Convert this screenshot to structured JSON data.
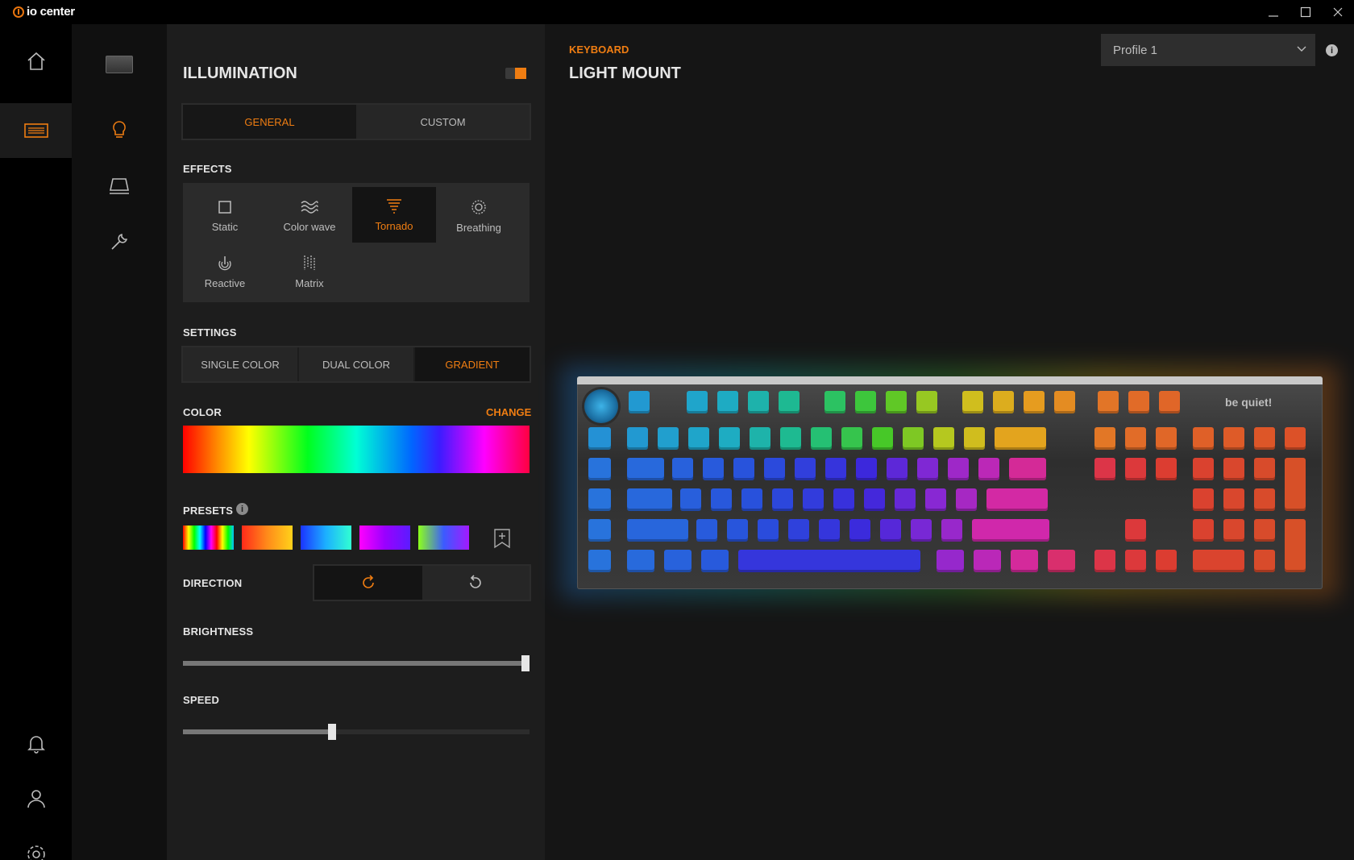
{
  "app": {
    "logo_text": "io center"
  },
  "panel": {
    "title": "ILLUMINATION",
    "tabs": [
      {
        "label": "GENERAL",
        "active": true
      },
      {
        "label": "CUSTOM",
        "active": false
      }
    ],
    "effects_label": "EFFECTS",
    "effects": [
      {
        "label": "Static",
        "icon": "square-icon"
      },
      {
        "label": "Color wave",
        "icon": "wave-icon"
      },
      {
        "label": "Tornado",
        "icon": "tornado-icon",
        "active": true
      },
      {
        "label": "Breathing",
        "icon": "breathing-icon"
      },
      {
        "label": "Reactive",
        "icon": "reactive-icon"
      },
      {
        "label": "Matrix",
        "icon": "matrix-icon"
      }
    ],
    "settings_label": "SETTINGS",
    "settings_modes": [
      {
        "label": "SINGLE COLOR"
      },
      {
        "label": "DUAL COLOR"
      },
      {
        "label": "GRADIENT",
        "active": true
      }
    ],
    "color_label": "COLOR",
    "change_label": "CHANGE",
    "presets_label": "PRESETS",
    "direction_label": "DIRECTION",
    "brightness_label": "BRIGHTNESS",
    "brightness_value": 1.0,
    "speed_label": "SPEED",
    "speed_value": 0.43
  },
  "main": {
    "breadcrumb": "KEYBOARD",
    "title": "LIGHT MOUNT",
    "profile": "Profile 1",
    "brand": "be quiet!"
  },
  "colors": {
    "accent": "#ef7d12"
  }
}
